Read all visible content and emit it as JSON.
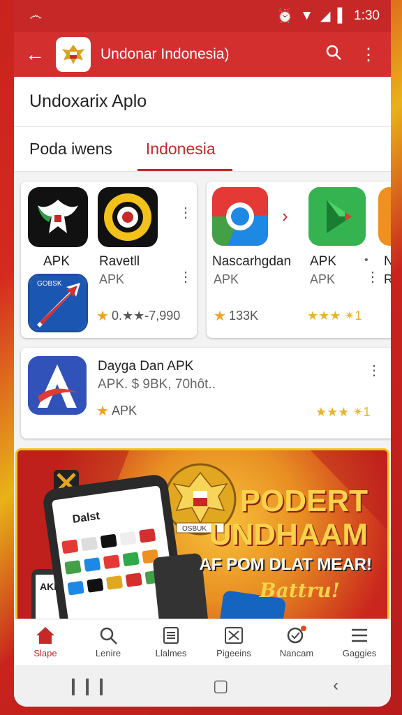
{
  "status": {
    "carrier_icon": "notification-icon",
    "time": "1:30"
  },
  "appbar": {
    "title": "Undonar Indonesia)"
  },
  "subheader": {
    "title": "Undoxarix Aplo"
  },
  "tabs": [
    {
      "label": "Poda iwens"
    },
    {
      "label": "Indonesia"
    }
  ],
  "cards": {
    "left": {
      "apps": [
        {
          "name": "APK"
        },
        {
          "name": "Ravetll",
          "sub": "APK"
        },
        {
          "badge": "GOBSK"
        }
      ],
      "rating": "0.★★-7,990"
    },
    "right": {
      "apps": [
        {
          "name": "Nascarhgdan",
          "sub": "APK"
        },
        {
          "name": "APK",
          "sub": "APK"
        },
        {
          "name": "N",
          "sub": "R"
        }
      ],
      "rating_left": "133K",
      "rating_right": "★★★ ✴1"
    },
    "wide": {
      "name": "Dayga Dan APK",
      "sub": "APK.  $  9BK, 70hôt..",
      "rating": "APK",
      "rating_right": "★★★ ✴1"
    }
  },
  "banner": {
    "line1": "PODERT",
    "line2": "UNDHAAM",
    "line3": "AF POM DLAT MEAR!",
    "line4": "Battru!",
    "phone_title": "Dalst",
    "phone_left_label": "AKK",
    "emblem_text": "OSBUK"
  },
  "bottom_nav": [
    {
      "label": "Slape",
      "icon": "home-icon"
    },
    {
      "label": "Lenire",
      "icon": "search-icon"
    },
    {
      "label": "Llalmes",
      "icon": "list-icon"
    },
    {
      "label": "Pigeeins",
      "icon": "box-icon"
    },
    {
      "label": "Nancam",
      "icon": "chat-icon"
    },
    {
      "label": "Gaggies",
      "icon": "menu-icon"
    }
  ],
  "colors": {
    "primary": "#d32f2f",
    "accent": "#c62828",
    "star": "#f0a020"
  }
}
